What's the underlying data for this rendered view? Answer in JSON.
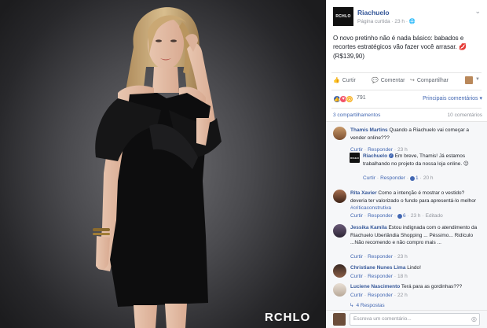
{
  "photo": {
    "watermark": "RCHLO"
  },
  "post": {
    "logo_text": "RCHLO",
    "page_name": "Riachuelo",
    "page_type": "Página curtida",
    "time": "23 h",
    "text": "O novo pretinho não é nada básico: babados e recortes estratégicos vão fazer você arrasar.",
    "emoji": "💋",
    "price": "(R$139,90)"
  },
  "actions": {
    "like": "Curtir",
    "comment": "Comentar",
    "share": "Compartilhar"
  },
  "reactions": {
    "count": "791",
    "top_comments": "Principais comentários"
  },
  "counts": {
    "shares": "3 compartilhamentos",
    "comments": "10 comentários"
  },
  "comments": [
    {
      "name": "Thamis Martins",
      "text": "Quando a Riachuelo vai começar a vender online???",
      "like": "Curtir",
      "reply": "Responder",
      "time": "23 h"
    },
    {
      "name": "Riachuelo",
      "text": "Em breve, Thamis! Já estamos trabalhando no projeto da nossa loja online. 😉",
      "like": "Curtir",
      "reply": "Responder",
      "likes": "1",
      "time": "20 h",
      "avatar_text": "RCHLO"
    },
    {
      "name": "Rita Xavier",
      "text": "Como a intenção é mostrar o vestido? deveria ter valorizado o fundo para apresentá-lo melhor",
      "hashtag": "#criticaconstrutiva",
      "like": "Curtir",
      "reply": "Responder",
      "likes": "6",
      "time": "23 h",
      "edited": "Editado"
    },
    {
      "name": "Jessika Kamila",
      "text": "Estou indignada com o atendimento da Riachuelo Uberlândia Shopping ... Péssimo... Ridículo ...Não recomendo e não compro mais ...",
      "like": "Curtir",
      "reply": "Responder",
      "time": "23 h"
    },
    {
      "name": "Christiane Nunes Lima",
      "text": "Lindo!",
      "like": "Curtir",
      "reply": "Responder",
      "time": "18 h"
    },
    {
      "name": "Luciene Nascimento",
      "text": "Terá para as gordinhas???",
      "like": "Curtir",
      "reply": "Responder",
      "time": "22 h"
    }
  ],
  "more_replies": "4 Respostas",
  "composer": {
    "placeholder": "Escreva um comentário..."
  },
  "colors": {
    "link": "#365899",
    "accent": "#4267b2",
    "meta": "#90949c",
    "comments_bg": "#f6f7f9"
  }
}
